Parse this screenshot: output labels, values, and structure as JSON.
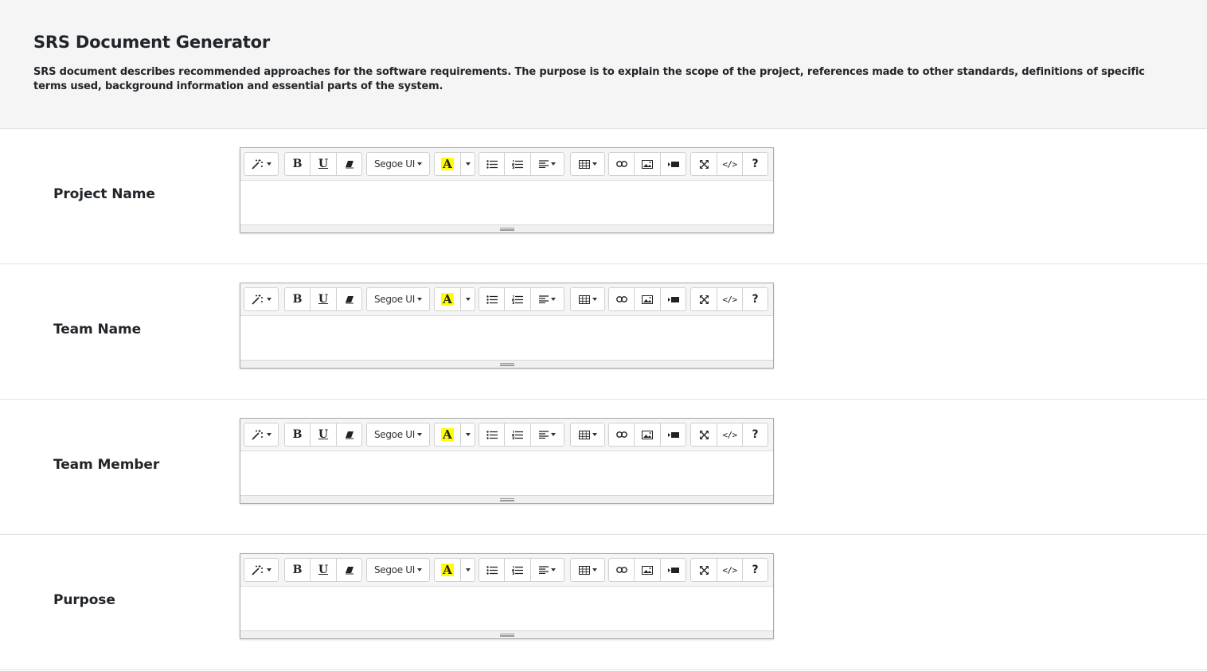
{
  "header": {
    "title": "SRS Document Generator",
    "description": "SRS document describes recommended approaches for the software requirements. The purpose is to explain the scope of the project, references made to other standards, definitions of specific terms used, background information and essential parts of the system."
  },
  "toolbar": {
    "font_name": "Segoe UI",
    "bold_glyph": "B",
    "underline_glyph": "U",
    "color_glyph": "A",
    "code_glyph": "</>",
    "help_glyph": "?",
    "highlight_color": "#ffff00"
  },
  "fields": [
    {
      "label": "Project Name",
      "value": ""
    },
    {
      "label": "Team Name",
      "value": ""
    },
    {
      "label": "Team Member",
      "value": ""
    },
    {
      "label": "Purpose",
      "value": ""
    }
  ]
}
